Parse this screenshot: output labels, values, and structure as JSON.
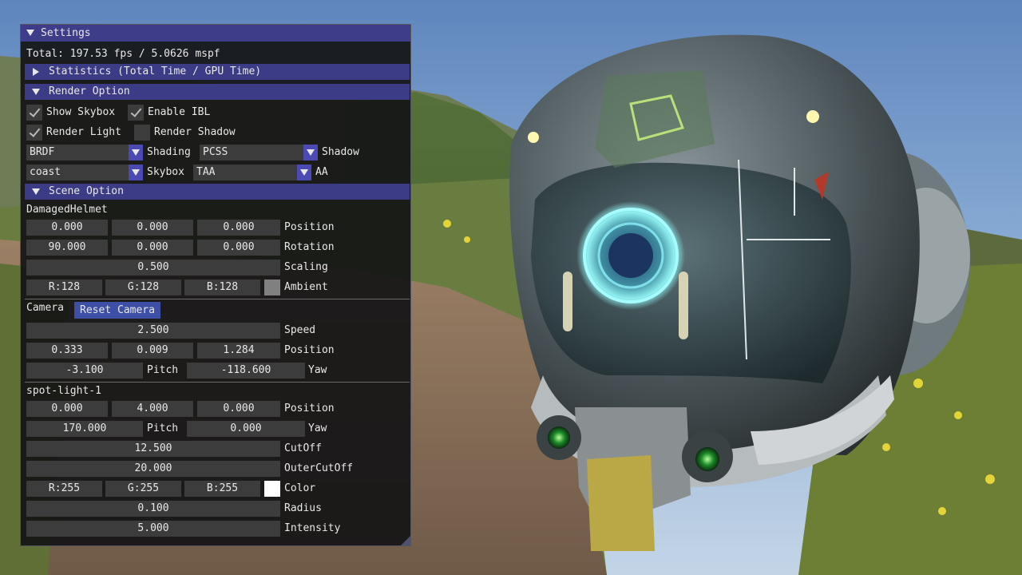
{
  "window": {
    "title": "Settings",
    "total_line": "Total: 197.53 fps / 5.0626 mspf"
  },
  "sections": {
    "statistics": "Statistics (Total Time / GPU Time)",
    "render_option": "Render Option",
    "scene_option": "Scene Option"
  },
  "render_option": {
    "show_skybox": {
      "label": "Show Skybox",
      "checked": true
    },
    "enable_ibl": {
      "label": "Enable IBL",
      "checked": true
    },
    "render_light": {
      "label": "Render Light",
      "checked": true
    },
    "render_shadow": {
      "label": "Render Shadow",
      "checked": false
    },
    "shading": {
      "value": "BRDF",
      "label": "Shading"
    },
    "shadow": {
      "value": "PCSS",
      "label": "Shadow"
    },
    "skybox": {
      "value": "coast",
      "label": "Skybox"
    },
    "aa": {
      "value": "TAA",
      "label": "AA"
    }
  },
  "model": {
    "name": "DamagedHelmet",
    "position": [
      "0.000",
      "0.000",
      "0.000"
    ],
    "position_label": "Position",
    "rotation": [
      "90.000",
      "0.000",
      "0.000"
    ],
    "rotation_label": "Rotation",
    "scaling": "0.500",
    "scaling_label": "Scaling",
    "ambient": [
      "R:128",
      "G:128",
      "B:128"
    ],
    "ambient_label": "Ambient",
    "ambient_color": "#808080"
  },
  "camera": {
    "label": "Camera",
    "reset_button": "Reset Camera",
    "speed": "2.500",
    "speed_label": "Speed",
    "position": [
      "0.333",
      "0.009",
      "1.284"
    ],
    "position_label": "Position",
    "pitch": "-3.100",
    "pitch_label": "Pitch",
    "yaw": "-118.600",
    "yaw_label": "Yaw"
  },
  "light": {
    "name": "spot-light-1",
    "position": [
      "0.000",
      "4.000",
      "0.000"
    ],
    "position_label": "Position",
    "pitch": "170.000",
    "pitch_label": "Pitch",
    "yaw": "0.000",
    "yaw_label": "Yaw",
    "cutoff": "12.500",
    "cutoff_label": "CutOff",
    "outer_cutoff": "20.000",
    "outer_cutoff_label": "OuterCutOff",
    "color": [
      "R:255",
      "G:255",
      "B:255"
    ],
    "color_label": "Color",
    "color_value": "#ffffff",
    "radius": "0.100",
    "radius_label": "Radius",
    "intensity": "5.000",
    "intensity_label": "Intensity"
  },
  "colors": {
    "title_bar": "#3d3d8a",
    "header": "#3c3c86",
    "field": "#3c3c3c",
    "accent_button": "#4a4ab2"
  }
}
